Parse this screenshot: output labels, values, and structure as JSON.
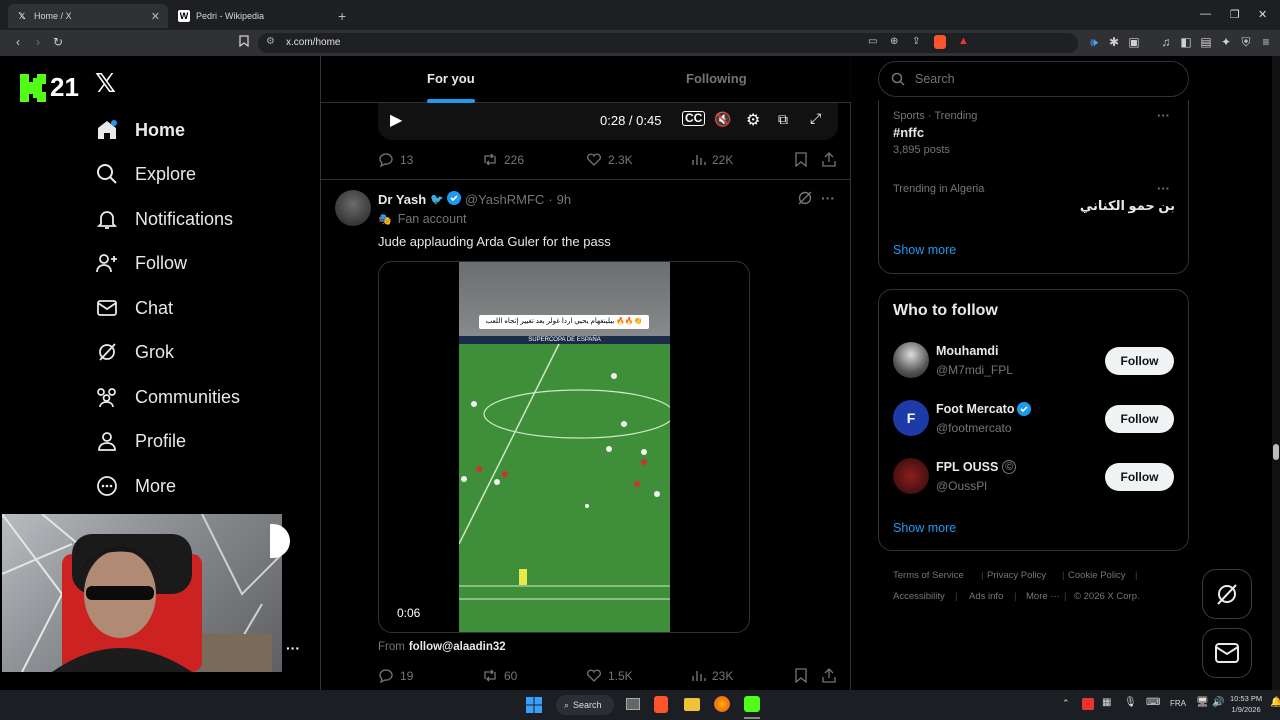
{
  "browser": {
    "tabs": [
      {
        "title": "Home / X",
        "favicon": "X",
        "active": true
      },
      {
        "title": "Pedri - Wikipedia",
        "favicon": "W",
        "active": false
      }
    ],
    "url": "x.com/home"
  },
  "left_nav": {
    "kick_badge": "21",
    "items": [
      {
        "id": "home",
        "label": "Home",
        "icon": "home-icon"
      },
      {
        "id": "explore",
        "label": "Explore",
        "icon": "search-icon"
      },
      {
        "id": "notifications",
        "label": "Notifications",
        "icon": "bell-icon"
      },
      {
        "id": "follow",
        "label": "Follow",
        "icon": "person-add-icon"
      },
      {
        "id": "chat",
        "label": "Chat",
        "icon": "envelope-icon"
      },
      {
        "id": "grok",
        "label": "Grok",
        "icon": "grok-icon"
      },
      {
        "id": "communities",
        "label": "Communities",
        "icon": "people-icon"
      },
      {
        "id": "profile",
        "label": "Profile",
        "icon": "person-icon"
      },
      {
        "id": "more",
        "label": "More",
        "icon": "more-circle-icon"
      }
    ],
    "more_dots": "···"
  },
  "feed": {
    "tabs": [
      "For you",
      "Following"
    ],
    "video1": {
      "time": "0:28 / 0:45"
    },
    "post1_actions": {
      "replies": "13",
      "reposts": "226",
      "likes": "2.3K",
      "views": "22K"
    },
    "post2": {
      "name": "Dr Yash",
      "handle": "@YashRMFC",
      "dot": "·",
      "time": "9h",
      "label": "Fan account",
      "text": "Jude applauding Arda Guler for the pass",
      "video_caption": "بيلينغهام يحيي اردا غولر بعد تغيير إتجاه اللعب 🔥🔥👏",
      "video_banner": "SUPERCOPA DE ESPAÑA",
      "video_time": "0:06",
      "from_label": "From",
      "from_handle": "follow@alaadin32",
      "actions": {
        "replies": "19",
        "reposts": "60",
        "likes": "1.5K",
        "views": "23K"
      }
    }
  },
  "right": {
    "search_placeholder": "Search",
    "trends": [
      {
        "context": "Sports · Trending",
        "title": "#nffc",
        "count": "3,895 posts"
      },
      {
        "context": "Trending in Algeria",
        "title": "بن حمو الكناني",
        "count": ""
      }
    ],
    "show_more": "Show more",
    "who_to_follow_title": "Who to follow",
    "who_to_follow": [
      {
        "name": "Mouhamdi",
        "handle": "@M7mdi_FPL",
        "button": "Follow"
      },
      {
        "name": "Foot Mercato",
        "handle": "@footmercato",
        "button": "Follow"
      },
      {
        "name": "FPL OUSS",
        "handle": "@OussPl",
        "button": "Follow"
      }
    ],
    "show_more_2": "Show more",
    "footer": [
      "Terms of Service",
      "Privacy Policy",
      "Cookie Policy",
      "Accessibility",
      "Ads info",
      "More ···",
      "© 2026 X Corp."
    ]
  },
  "taskbar": {
    "search": "Search",
    "lang": "FRA",
    "time": "10:53 PM",
    "date": "1/9/2026"
  },
  "colors": {
    "accent": "#1d9bf0",
    "background": "#000000",
    "border": "#2f3336",
    "muted": "#71767b",
    "kick_green": "#53fc18"
  }
}
